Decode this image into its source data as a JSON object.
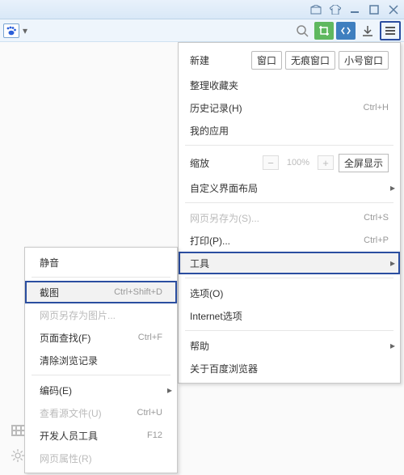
{
  "titlebar": {
    "icons": [
      "box-icon",
      "shirt-icon",
      "minimize-icon",
      "maximize-icon",
      "close-icon"
    ]
  },
  "toolbar": {
    "icons": [
      "search-icon",
      "crop-icon",
      "vscode-icon",
      "download-icon",
      "menu-icon"
    ]
  },
  "main_menu": {
    "new_label": "新建",
    "new_options": {
      "window": "窗口",
      "private": "无痕窗口",
      "small": "小号窗口"
    },
    "favorites": "整理收藏夹",
    "history": "历史记录(H)",
    "history_shortcut": "Ctrl+H",
    "apps": "我的应用",
    "zoom": "缩放",
    "zoom_value": "100%",
    "fullscreen": "全屏显示",
    "layout": "自定义界面布局",
    "saveas": "网页另存为(S)...",
    "saveas_shortcut": "Ctrl+S",
    "print": "打印(P)...",
    "print_shortcut": "Ctrl+P",
    "tools": "工具",
    "options": "选项(O)",
    "inetopt": "Internet选项",
    "help": "帮助",
    "about": "关于百度浏览器"
  },
  "tools_menu": {
    "mute": "静音",
    "screenshot": "截图",
    "screenshot_shortcut": "Ctrl+Shift+D",
    "save_img": "网页另存为图片...",
    "find": "页面查找(F)",
    "find_shortcut": "Ctrl+F",
    "clear": "清除浏览记录",
    "encoding": "编码(E)",
    "view_source": "查看源文件(U)",
    "view_source_shortcut": "Ctrl+U",
    "devtools": "开发人员工具",
    "devtools_shortcut": "F12",
    "page_props": "网页属性(R)"
  }
}
